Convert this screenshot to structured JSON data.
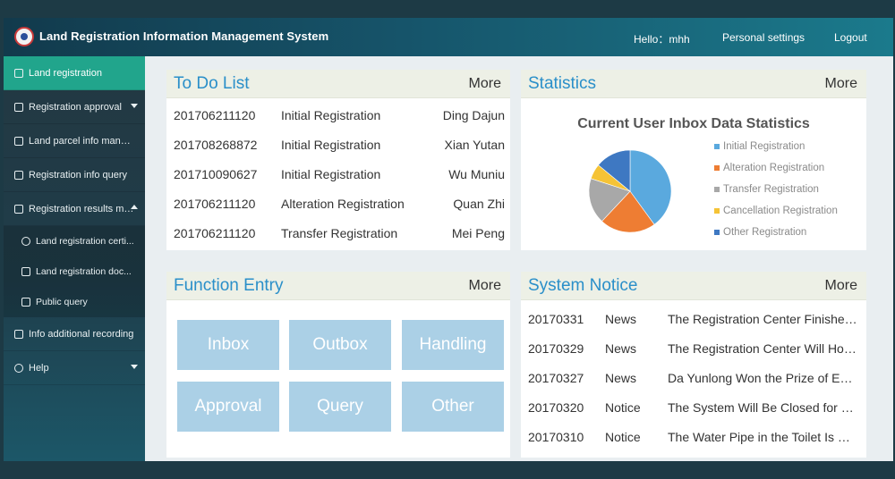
{
  "header": {
    "title": "Land Registration Information Management System",
    "hello": "Hello：mhh",
    "settings": "Personal settings",
    "logout": "Logout"
  },
  "sidebar": {
    "items": [
      {
        "label": "Land registration",
        "icon": "home-icon"
      },
      {
        "label": "Registration approval",
        "icon": "calendar-icon"
      },
      {
        "label": "Land parcel info mana...",
        "icon": "parcel-icon"
      },
      {
        "label": "Registration info query",
        "icon": "document-icon"
      },
      {
        "label": "Registration results ma...",
        "icon": "edit-icon"
      },
      {
        "label": "Land registration certi...",
        "icon": "certificate-icon"
      },
      {
        "label": "Land registration doc...",
        "icon": "file-icon"
      },
      {
        "label": "Public query",
        "icon": "search-document-icon"
      },
      {
        "label": "Info additional recording",
        "icon": "note-icon"
      },
      {
        "label": "Help",
        "icon": "help-icon"
      }
    ]
  },
  "todo": {
    "title": "To Do List",
    "more": "More",
    "rows": [
      {
        "id": "201706211120",
        "type": "Initial Registration",
        "name": "Ding Dajun"
      },
      {
        "id": "201708268872",
        "type": "Initial Registration",
        "name": "Xian Yutan"
      },
      {
        "id": "201710090627",
        "type": "Initial Registration",
        "name": "Wu Muniu"
      },
      {
        "id": "201706211120",
        "type": "Alteration Registration",
        "name": "Quan Zhi"
      },
      {
        "id": "201706211120",
        "type": "Transfer Registration",
        "name": "Mei Peng"
      }
    ]
  },
  "stats": {
    "title": "Statistics",
    "more": "More",
    "chart_title": "Current User Inbox Data Statistics",
    "legend": [
      {
        "label": "Initial Registration",
        "color": "#5aa9de",
        "value": 40
      },
      {
        "label": "Alteration Registration",
        "color": "#ee7d33",
        "value": 22
      },
      {
        "label": "Transfer Registration",
        "color": "#a8a8a8",
        "value": 18
      },
      {
        "label": "Cancellation Registration",
        "color": "#f5c336",
        "value": 6
      },
      {
        "label": "Other Registration",
        "color": "#3e78c2",
        "value": 14
      }
    ]
  },
  "functions": {
    "title": "Function Entry",
    "more": "More",
    "tiles": [
      "Inbox",
      "Outbox",
      "Handling",
      "Approval",
      "Query",
      "Other"
    ]
  },
  "notice": {
    "title": "System Notice",
    "more": "More",
    "rows": [
      {
        "date": "20170331",
        "cat": "News",
        "text": "The Registration Center Finished the Work of the Year"
      },
      {
        "date": "20170329",
        "cat": "News",
        "text": "The Registration Center Will Hold a Meeting"
      },
      {
        "date": "20170327",
        "cat": "News",
        "text": "Da Yunlong Won the Prize of Excellent Employee"
      },
      {
        "date": "20170320",
        "cat": "Notice",
        "text": "The System Will Be Closed for Maintenance"
      },
      {
        "date": "20170310",
        "cat": "Notice",
        "text": "The Water Pipe in the Toilet Is Broken"
      }
    ]
  }
}
